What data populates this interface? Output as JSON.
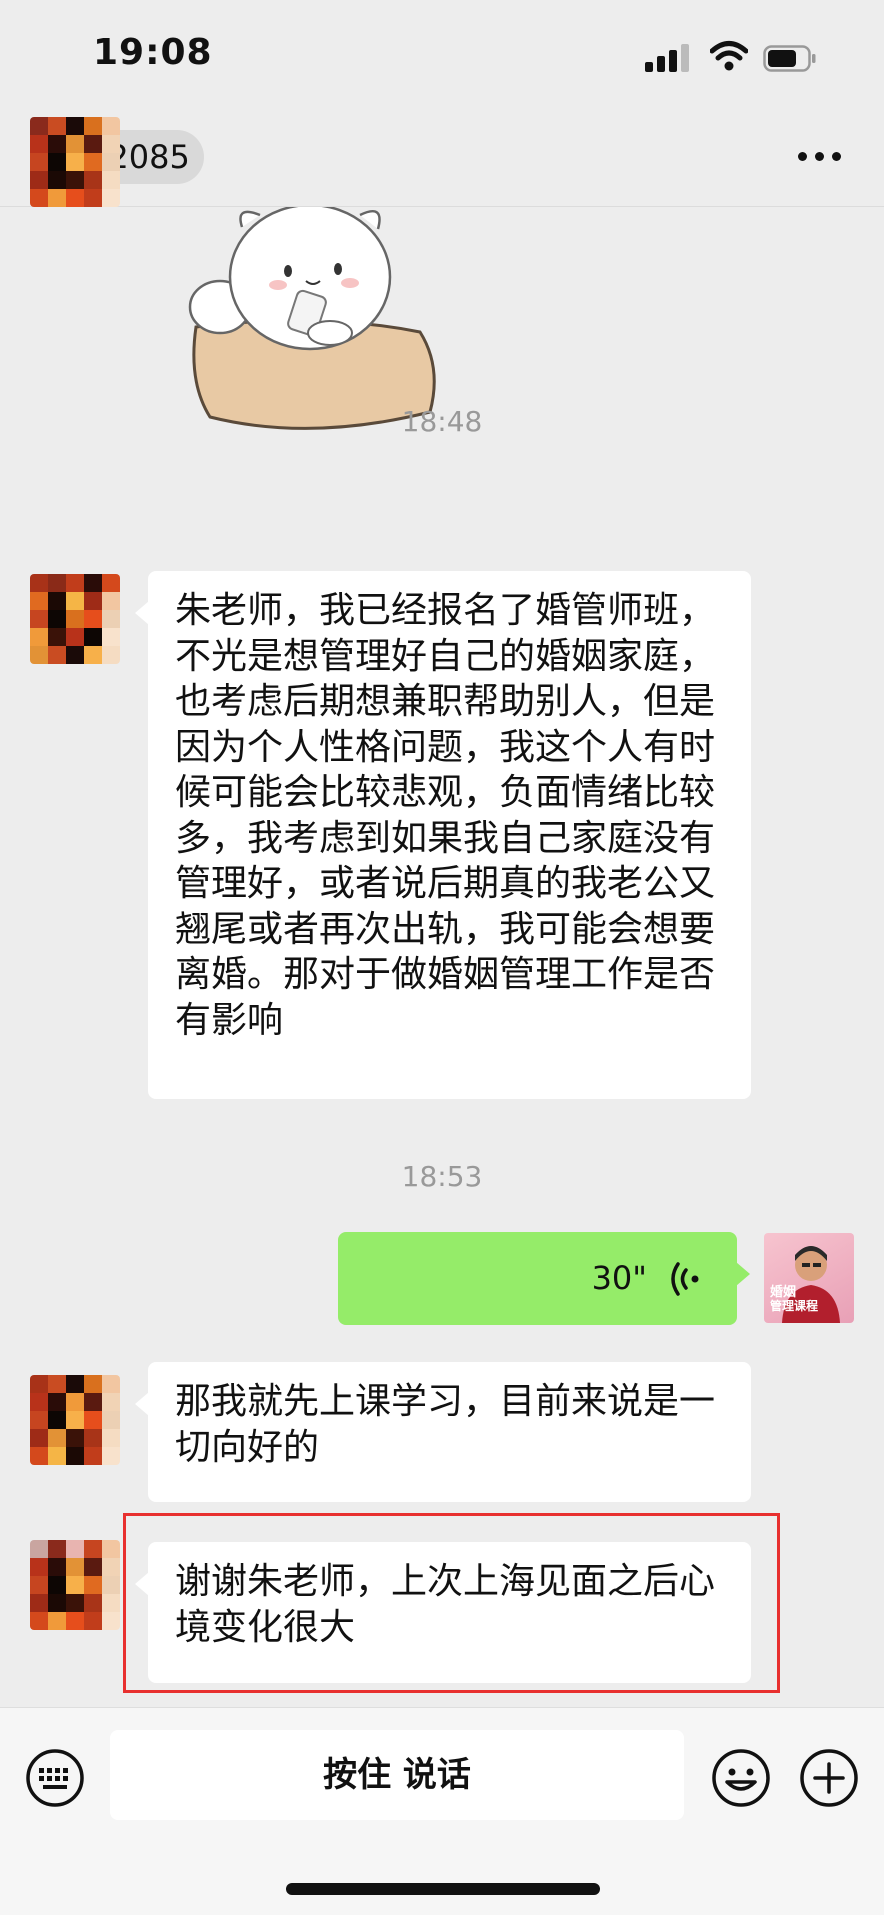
{
  "status_bar": {
    "time": "19:08"
  },
  "nav": {
    "title": "12085"
  },
  "messages": {
    "time_1": "18:48",
    "msg_1": "朱老师，我已经报名了婚管师班，不光是想管理好自己的婚姻家庭，也考虑后期想兼职帮助别人，但是因为个人性格问题，我这个人有时候可能会比较悲观，负面情绪比较多，我考虑到如果我自己家庭没有管理好，或者说后期真的我老公又翘尾或者再次出轨，我可能会想要离婚。那对于做婚姻管理工作是否有影响",
    "time_2": "18:53",
    "voice_duration": "30\"",
    "msg_2": "那我就先上课学习，目前来说是一切向好的",
    "msg_3": "谢谢朱老师，上次上海见面之后心境变化很大"
  },
  "input_bar": {
    "talk_label": "按住 说话"
  },
  "teacher_avatar": {
    "line1": "婚姻",
    "line2": "管理课程"
  },
  "colors": {
    "voice_bubble": "#95ec69",
    "highlight": "#e8302f",
    "background": "#ededed"
  },
  "icons": [
    "back-icon",
    "more-icon",
    "voice-wave-icon",
    "keyboard-icon",
    "emoji-icon",
    "plus-icon"
  ]
}
